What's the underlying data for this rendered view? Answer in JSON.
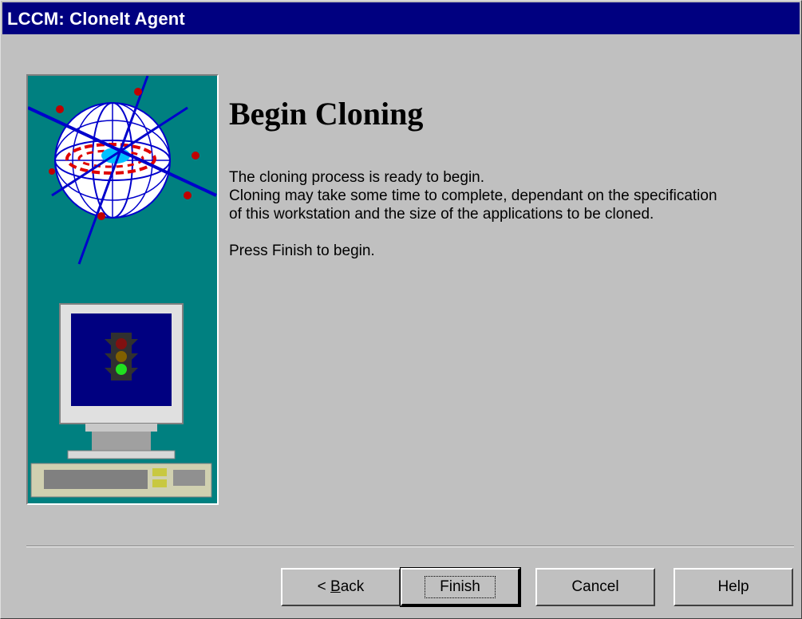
{
  "window": {
    "title": "LCCM: CloneIt Agent"
  },
  "main": {
    "heading": "Begin Cloning",
    "lines": [
      "The cloning process is ready to begin.",
      "Cloning may take some time to complete, dependant on the specification",
      "of this workstation and the size of the applications to be cloned."
    ],
    "prompt": "Press Finish to begin."
  },
  "buttons": {
    "back_prefix": "< ",
    "back_mnemonic": "B",
    "back_rest": "ack",
    "finish": "Finish",
    "cancel": "Cancel",
    "help": "Help"
  },
  "sidebar": {
    "illustration": "globe-and-computer-with-traffic-light",
    "traffic_light_active": "green"
  },
  "colors": {
    "titlebar": "#000080",
    "panel": "#008080",
    "face": "#c0c0c0"
  }
}
